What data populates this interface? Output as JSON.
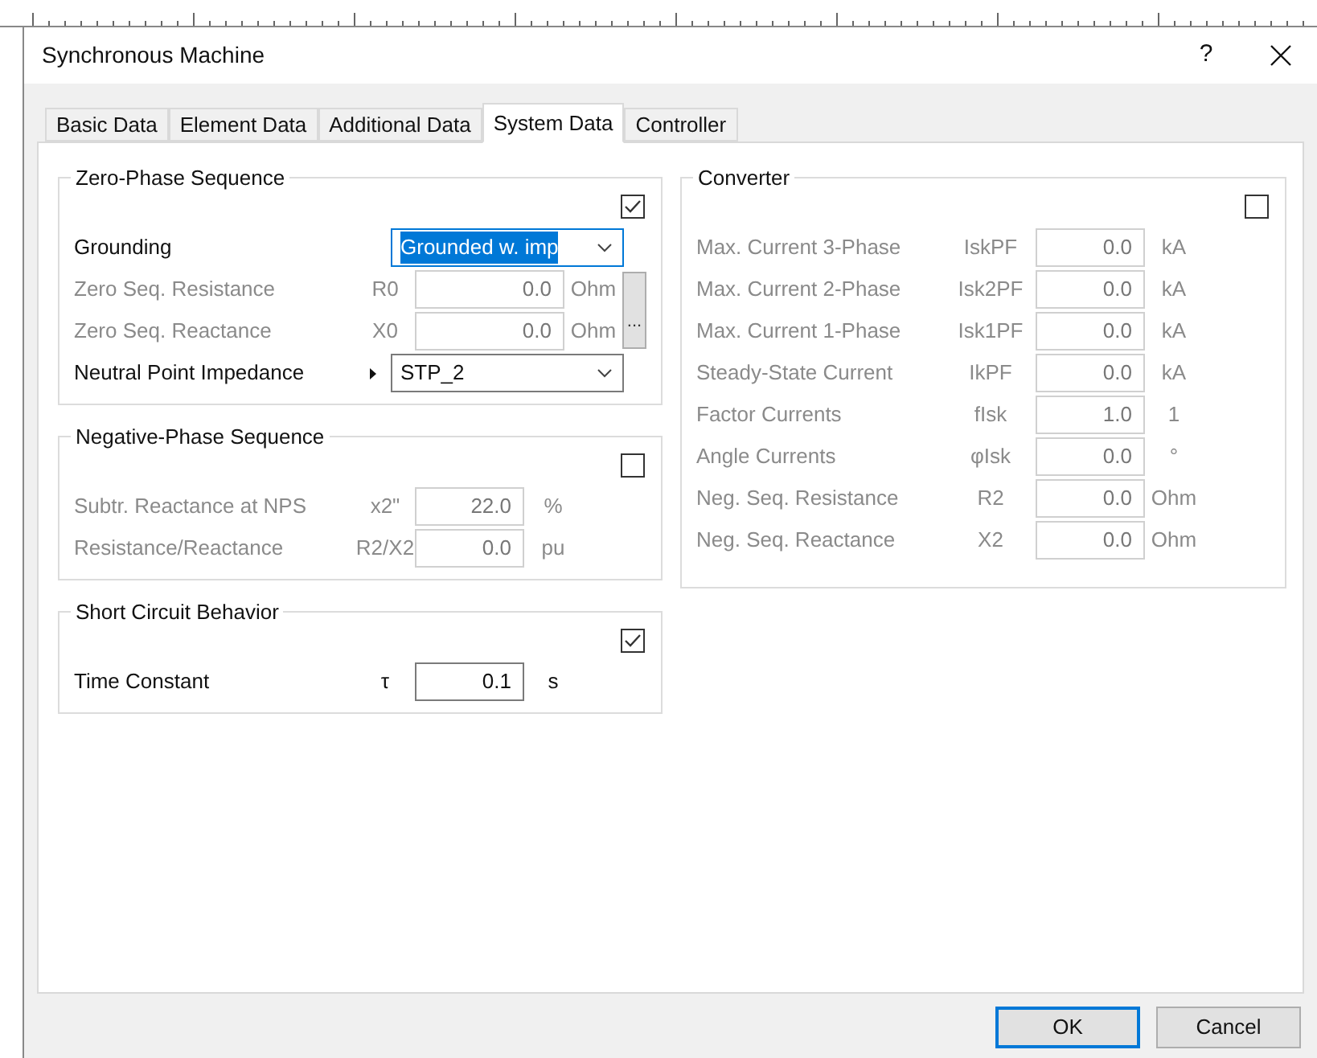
{
  "window": {
    "title": "Synchronous Machine",
    "help": "?"
  },
  "tabs": [
    {
      "label": "Basic Data",
      "selected": false
    },
    {
      "label": "Element Data",
      "selected": false
    },
    {
      "label": "Additional Data",
      "selected": false
    },
    {
      "label": "System Data",
      "selected": true
    },
    {
      "label": "Controller",
      "selected": false
    }
  ],
  "zero_phase": {
    "title": "Zero-Phase Sequence",
    "checked": true,
    "more_button": "...",
    "rows": [
      {
        "kind": "dropdown",
        "label": "Grounding",
        "value": "Grounded w. imp",
        "disabled": false,
        "focused": true,
        "pointer": false
      },
      {
        "kind": "number",
        "label": "Zero Seq. Resistance",
        "symbol": "R0",
        "value": "0.0",
        "unit": "Ohm",
        "disabled": true
      },
      {
        "kind": "number",
        "label": "Zero Seq. Reactance",
        "symbol": "X0",
        "value": "0.0",
        "unit": "Ohm",
        "disabled": true
      },
      {
        "kind": "dropdown",
        "label": "Neutral Point Impedance",
        "value": "STP_2",
        "disabled": false,
        "focused": false,
        "pointer": true
      }
    ]
  },
  "negative_phase": {
    "title": "Negative-Phase Sequence",
    "checked": false,
    "rows": [
      {
        "label": "Subtr. Reactance at NPS",
        "symbol": "x2\"",
        "value": "22.0",
        "unit": "%",
        "disabled": true
      },
      {
        "label": "Resistance/Reactance",
        "symbol": "R2/X2",
        "value": "0.0",
        "unit": "pu",
        "disabled": true
      }
    ]
  },
  "short_circuit": {
    "title": "Short Circuit Behavior",
    "checked": true,
    "rows": [
      {
        "label": "Time Constant",
        "symbol": "τ",
        "value": "0.1",
        "unit": "s",
        "disabled": false
      }
    ]
  },
  "converter": {
    "title": "Converter",
    "checked": false,
    "rows": [
      {
        "label": "Max. Current 3-Phase",
        "symbol": "IskPF",
        "value": "0.0",
        "unit": "kA",
        "disabled": true
      },
      {
        "label": "Max. Current 2-Phase",
        "symbol": "Isk2PF",
        "value": "0.0",
        "unit": "kA",
        "disabled": true
      },
      {
        "label": "Max. Current 1-Phase",
        "symbol": "Isk1PF",
        "value": "0.0",
        "unit": "kA",
        "disabled": true
      },
      {
        "label": "Steady-State Current",
        "symbol": "IkPF",
        "value": "0.0",
        "unit": "kA",
        "disabled": true
      },
      {
        "label": "Factor Currents",
        "symbol": "fIsk",
        "value": "1.0",
        "unit": "1",
        "disabled": true
      },
      {
        "label": "Angle Currents",
        "symbol": "φIsk",
        "value": "0.0",
        "unit": "°",
        "disabled": true
      },
      {
        "label": "Neg. Seq. Resistance",
        "symbol": "R2",
        "value": "0.0",
        "unit": "Ohm",
        "disabled": true
      },
      {
        "label": "Neg. Seq. Reactance",
        "symbol": "X2",
        "value": "0.0",
        "unit": "Ohm",
        "disabled": true
      }
    ]
  },
  "buttons": [
    {
      "label": "OK",
      "default": true
    },
    {
      "label": "Cancel",
      "default": false
    }
  ]
}
